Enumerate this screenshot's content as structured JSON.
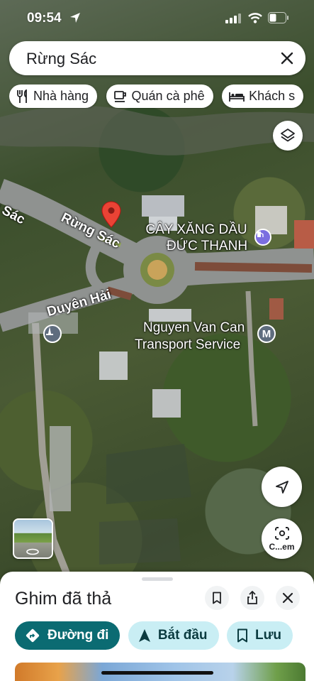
{
  "status_bar": {
    "time": "09:54"
  },
  "search": {
    "query": "Rừng Sác"
  },
  "chips": [
    {
      "icon": "restaurant-icon",
      "label": "Nhà hàng"
    },
    {
      "icon": "coffee-icon",
      "label": "Quán cà phê"
    },
    {
      "icon": "hotel-icon",
      "label": "Khách s"
    }
  ],
  "map": {
    "road_labels": [
      "g Sác",
      "Rừng Sác",
      "Duyên Hải"
    ],
    "poi_labels": [
      {
        "line1": "CÂY XĂNG DẦU",
        "line2": "ĐỨC THANH",
        "icon": "gas-station-icon"
      },
      {
        "line1": "Nguyen Van Can",
        "line2": "Transport Service",
        "icon": "metro-icon"
      }
    ],
    "pin_color": "#ea4335"
  },
  "controls": {
    "lens_label": "C...em"
  },
  "sheet": {
    "title": "Ghim đã thả",
    "actions": {
      "directions": "Đường đi",
      "start": "Bắt đầu",
      "save": "Lưu"
    }
  },
  "colors": {
    "primary": "#0b6b72",
    "tonal": "#c9eef4"
  }
}
